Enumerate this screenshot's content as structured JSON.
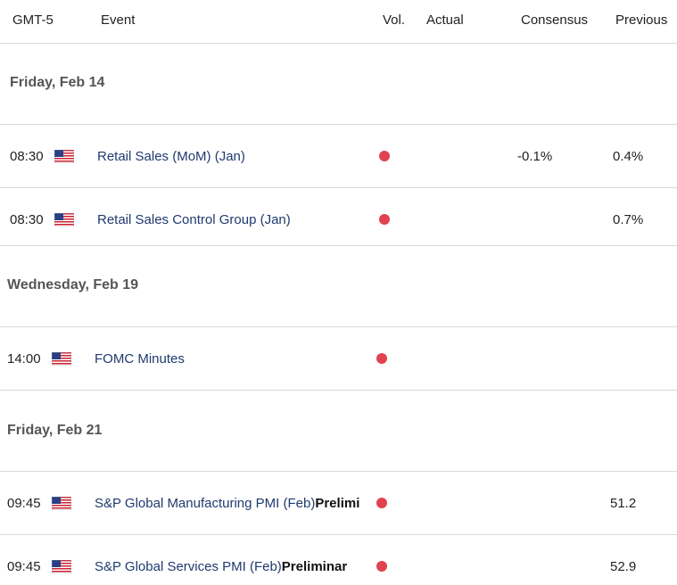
{
  "header": {
    "timezone": "GMT-5",
    "event": "Event",
    "vol": "Vol.",
    "actual": "Actual",
    "consensus": "Consensus",
    "previous": "Previous"
  },
  "dates": [
    {
      "label": "Friday, Feb 14"
    },
    {
      "label": "Wednesday, Feb 19"
    },
    {
      "label": "Friday, Feb 21"
    }
  ],
  "events": [
    {
      "time": "08:30",
      "country_icon": "us-flag-icon",
      "name": "Retail Sales (MoM) (Jan)",
      "name_bold": "",
      "volatility": "high",
      "actual": "",
      "consensus": "-0.1%",
      "previous": "0.4%"
    },
    {
      "time": "08:30",
      "country_icon": "us-flag-icon",
      "name": "Retail Sales Control Group (Jan)",
      "name_bold": "",
      "volatility": "high",
      "actual": "",
      "consensus": "",
      "previous": "0.7%"
    },
    {
      "time": "14:00",
      "country_icon": "us-flag-icon",
      "name": "FOMC Minutes",
      "name_bold": "",
      "volatility": "high",
      "actual": "",
      "consensus": "",
      "previous": ""
    },
    {
      "time": "09:45",
      "country_icon": "us-flag-icon",
      "name": "S&P Global Manufacturing PMI (Feb)",
      "name_bold": "Prelimi",
      "volatility": "high",
      "actual": "",
      "consensus": "",
      "previous": "51.2"
    },
    {
      "time": "09:45",
      "country_icon": "us-flag-icon",
      "name": "S&P Global Services PMI (Feb)",
      "name_bold": "Preliminar",
      "volatility": "high",
      "actual": "",
      "consensus": "",
      "previous": "52.9"
    }
  ],
  "colors": {
    "volatility_high": "#e0434f",
    "event_link": "#1f3a6e",
    "date_text": "#555555"
  }
}
